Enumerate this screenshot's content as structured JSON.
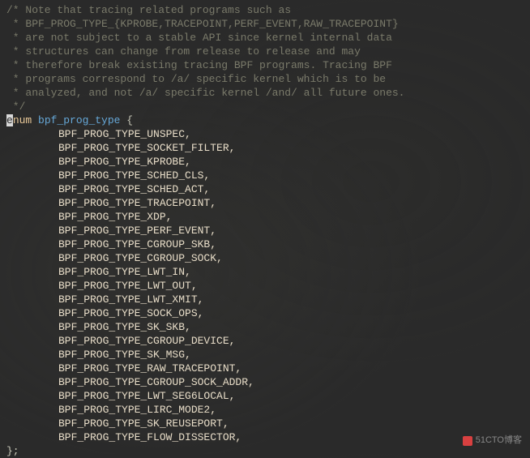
{
  "comments": [
    "/* Note that tracing related programs such as",
    " * BPF_PROG_TYPE_{KPROBE,TRACEPOINT,PERF_EVENT,RAW_TRACEPOINT}",
    " * are not subject to a stable API since kernel internal data",
    " * structures can change from release to release and may",
    " * therefore break existing tracing BPF programs. Tracing BPF",
    " * programs correspond to /a/ specific kernel which is to be",
    " * analyzed, and not /a/ specific kernel /and/ all future ones.",
    " */"
  ],
  "enum_declaration": {
    "cursor_char": "e",
    "keyword": "num",
    "name": "bpf_prog_type",
    "open_brace": " {"
  },
  "enum_values": [
    "BPF_PROG_TYPE_UNSPEC,",
    "BPF_PROG_TYPE_SOCKET_FILTER,",
    "BPF_PROG_TYPE_KPROBE,",
    "BPF_PROG_TYPE_SCHED_CLS,",
    "BPF_PROG_TYPE_SCHED_ACT,",
    "BPF_PROG_TYPE_TRACEPOINT,",
    "BPF_PROG_TYPE_XDP,",
    "BPF_PROG_TYPE_PERF_EVENT,",
    "BPF_PROG_TYPE_CGROUP_SKB,",
    "BPF_PROG_TYPE_CGROUP_SOCK,",
    "BPF_PROG_TYPE_LWT_IN,",
    "BPF_PROG_TYPE_LWT_OUT,",
    "BPF_PROG_TYPE_LWT_XMIT,",
    "BPF_PROG_TYPE_SOCK_OPS,",
    "BPF_PROG_TYPE_SK_SKB,",
    "BPF_PROG_TYPE_CGROUP_DEVICE,",
    "BPF_PROG_TYPE_SK_MSG,",
    "BPF_PROG_TYPE_RAW_TRACEPOINT,",
    "BPF_PROG_TYPE_CGROUP_SOCK_ADDR,",
    "BPF_PROG_TYPE_LWT_SEG6LOCAL,",
    "BPF_PROG_TYPE_LIRC_MODE2,",
    "BPF_PROG_TYPE_SK_REUSEPORT,",
    "BPF_PROG_TYPE_FLOW_DISSECTOR,"
  ],
  "close": "};",
  "watermark": "51CTO博客"
}
